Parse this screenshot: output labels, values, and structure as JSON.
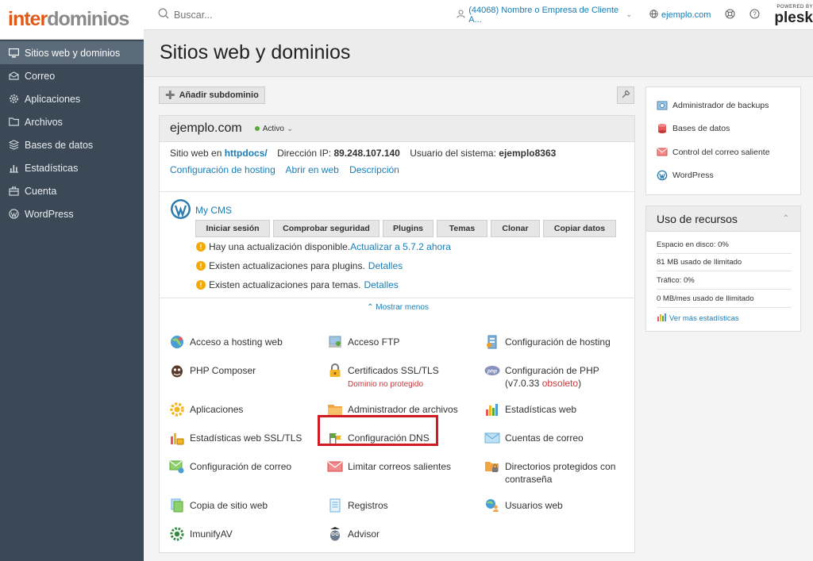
{
  "brand": {
    "logo_part1": "inter",
    "logo_part2": "dominios"
  },
  "sidebar": {
    "items": [
      {
        "label": "Sitios web y dominios",
        "icon": "monitor-icon",
        "active": true
      },
      {
        "label": "Correo",
        "icon": "mail-icon"
      },
      {
        "label": "Aplicaciones",
        "icon": "gear-icon"
      },
      {
        "label": "Archivos",
        "icon": "folder-icon"
      },
      {
        "label": "Bases de datos",
        "icon": "database-icon"
      },
      {
        "label": "Estadísticas",
        "icon": "bar-chart-icon"
      },
      {
        "label": "Cuenta",
        "icon": "briefcase-icon"
      },
      {
        "label": "WordPress",
        "icon": "wordpress-icon"
      }
    ]
  },
  "topbar": {
    "search_placeholder": "Buscar...",
    "account": "(44068) Nombre o Empresa de Cliente A...",
    "domain": "ejemplo.com",
    "powered_by": "POWERED BY",
    "plesk": "plesk"
  },
  "page": {
    "title": "Sitios web y dominios"
  },
  "toolbar": {
    "add_subdomain": "Añadir subdominio"
  },
  "domain_card": {
    "name": "ejemplo.com",
    "status": "Activo",
    "site_prefix": "Sitio web en",
    "site_dir": "httpdocs/",
    "ip_label": "Dirección IP:",
    "ip": "89.248.107.140",
    "user_label": "Usuario del sistema:",
    "user": "ejemplo8363",
    "links": [
      "Configuración de hosting",
      "Abrir en web",
      "Descripción"
    ],
    "cms": {
      "title": "My CMS",
      "buttons": [
        "Iniciar sesión",
        "Comprobar seguridad",
        "Plugins",
        "Temas",
        "Clonar",
        "Copiar datos"
      ],
      "warnings": [
        {
          "text": "Hay una actualización disponible.",
          "link": "Actualizar a 5.7.2 ahora"
        },
        {
          "text": "Existen actualizaciones para plugins.",
          "link": "Detalles"
        },
        {
          "text": "Existen actualizaciones para temas.",
          "link": "Detalles"
        }
      ]
    },
    "show_less": "Mostrar menos",
    "tools": [
      {
        "label": "Acceso a hosting web"
      },
      {
        "label": "Acceso FTP"
      },
      {
        "label": "Configuración de hosting"
      },
      {
        "label": "PHP Composer"
      },
      {
        "label": "Certificados SSL/TLS",
        "sub": "Dominio no protegido"
      },
      {
        "label": "Configuración de PHP",
        "sub_prefix": "(v7.0.33 ",
        "sub_link": "obsoleto",
        "sub_suffix": ")"
      },
      {
        "label": "Aplicaciones"
      },
      {
        "label": "Administrador de archivos"
      },
      {
        "label": "Estadísticas web"
      },
      {
        "label": "Estadísticas web SSL/TLS"
      },
      {
        "label": "Configuración DNS"
      },
      {
        "label": "Cuentas de correo"
      },
      {
        "label": "Configuración de correo"
      },
      {
        "label": "Limitar correos salientes"
      },
      {
        "label": "Directorios protegidos con",
        "label2": "contraseña"
      },
      {
        "label": "Copia de sitio web"
      },
      {
        "label": "Registros"
      },
      {
        "label": "Usuarios web"
      },
      {
        "label": "ImunifyAV"
      },
      {
        "label": "Advisor"
      }
    ]
  },
  "right_links": [
    "Administrador de backups",
    "Bases de datos",
    "Control del correo saliente",
    "WordPress"
  ],
  "resources": {
    "title": "Uso de recursos",
    "disk": "Espacio en disco: 0%",
    "disk_used": "81 MB usado de Ilimitado",
    "traffic": "Tráfico: 0%",
    "traffic_used": "0 MB/mes usado de Ilimitado",
    "more": "Ver más estadísticas"
  },
  "colors": {
    "sidebar": "#3b4956",
    "active": "#5b6b7a",
    "link": "#1a7db5",
    "highlight": "#d11b24",
    "logo_orange": "#e05a17"
  }
}
